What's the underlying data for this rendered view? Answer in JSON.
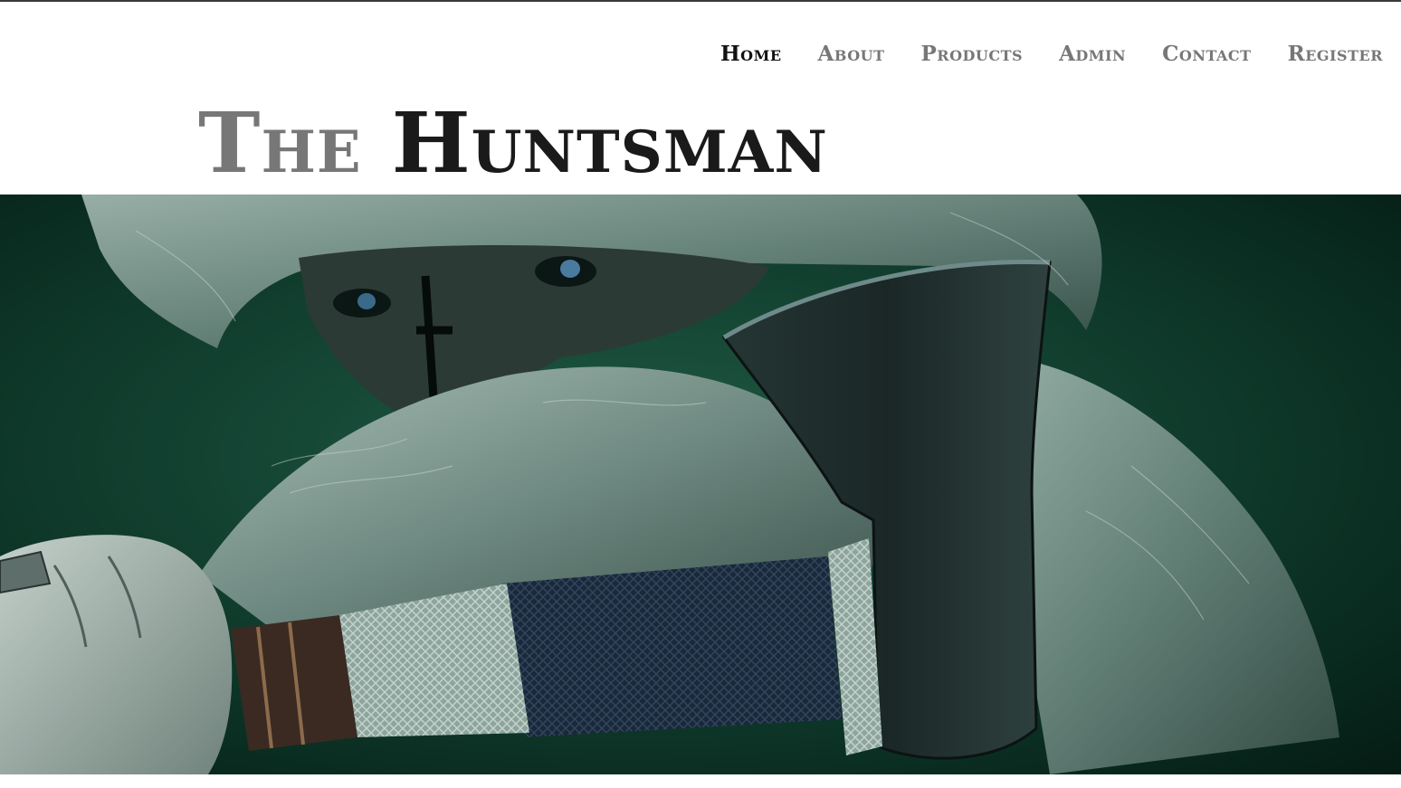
{
  "nav": {
    "items": [
      {
        "label": "Home",
        "active": true
      },
      {
        "label": "About",
        "active": false
      },
      {
        "label": "Products",
        "active": false
      },
      {
        "label": "Admin",
        "active": false
      },
      {
        "label": "Contact",
        "active": false
      },
      {
        "label": "Register",
        "active": false
      }
    ]
  },
  "header": {
    "title_prefix": "The",
    "title_main": "Huntsman"
  },
  "hero": {
    "image_description_name": "hunter-with-axe-hero-image",
    "colors": {
      "background": "#0a2a1e",
      "fur": "#8fa8a0",
      "axe_head": "#1c2b2a",
      "grip_light": "#9fb3ad",
      "grip_dark": "#1e2a3a",
      "skin": "#a9b8b0"
    }
  },
  "theme": {
    "title_prefix_color": "#777777",
    "title_main_color": "#1a1a1a",
    "nav_color": "#777777",
    "nav_active_color": "#111111",
    "top_rule_color": "#3a3a3a"
  }
}
